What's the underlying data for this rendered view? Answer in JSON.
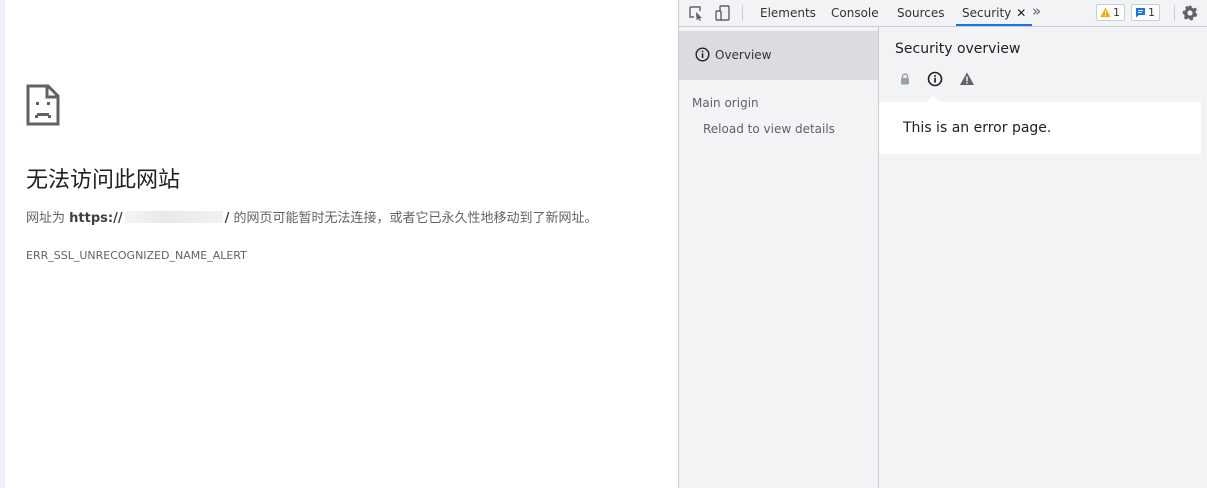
{
  "error_page": {
    "title": "无法访问此网站",
    "desc_prefix": "网址为",
    "url_scheme": "https://",
    "url_suffix": "/",
    "desc_suffix": "的网页可能暂时无法连接，或者它已永久性地移动到了新网址。",
    "error_code": "ERR_SSL_UNRECOGNIZED_NAME_ALERT",
    "icon": "sad-page-icon"
  },
  "devtools": {
    "toolbar": {
      "tabs": [
        {
          "label": "Elements"
        },
        {
          "label": "Console"
        },
        {
          "label": "Sources"
        },
        {
          "label": "Security",
          "active": true
        }
      ],
      "close_glyph": "✕",
      "more_glyph": "»",
      "warnings_count": "1",
      "messages_count": "1",
      "icons": [
        "inspect-element-icon",
        "device-toggle-icon",
        "more-tabs-icon",
        "warning-icon",
        "message-icon",
        "gear-icon"
      ]
    },
    "sidebar": {
      "overview_label": "Overview",
      "main_origin_label": "Main origin",
      "reload_label": "Reload to view details"
    },
    "panel": {
      "title": "Security overview",
      "icons": [
        "lock-icon",
        "info-icon",
        "warning-icon"
      ],
      "message": "This is an error page."
    },
    "colors": {
      "accent": "#1a73e8",
      "warning": "#f9ab00",
      "message": "#1a73e8",
      "panel_bg": "#f1f3f4",
      "selected_bg": "#dadce0"
    }
  }
}
